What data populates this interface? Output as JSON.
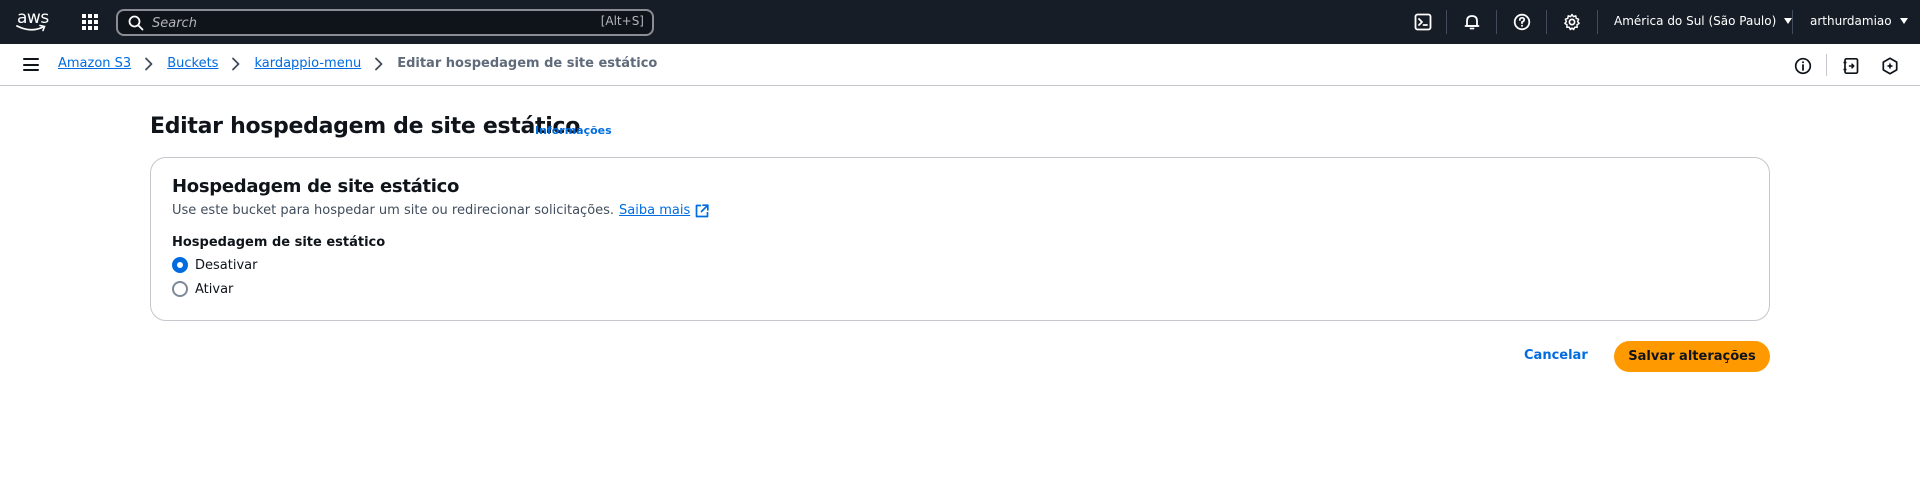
{
  "topnav": {
    "logo_text": "aws",
    "search": {
      "placeholder": "Search",
      "shortcut": "[Alt+S]"
    },
    "icons": [
      "apps-grid-icon",
      "cloudshell-icon",
      "notifications-bell-icon",
      "help-icon",
      "settings-gear-icon"
    ],
    "region": "América do Sul (São Paulo)",
    "account": "arthurdamiao"
  },
  "breadcrumb": {
    "items": [
      {
        "label": "Amazon S3"
      },
      {
        "label": "Buckets"
      },
      {
        "label": "kardappio-menu"
      }
    ],
    "current": "Editar hospedagem de site estático"
  },
  "tools": [
    "info-icon",
    "notes-icon",
    "ai-assistant-icon"
  ],
  "page": {
    "title": "Editar hospedagem de site estático",
    "info_link": "Informações"
  },
  "panel": {
    "title": "Hospedagem de site estático",
    "description": "Use este bucket para hospedar um site ou redirecionar solicitações.",
    "learn_more": "Saiba mais",
    "field_label": "Hospedagem de site estático",
    "options": [
      {
        "label": "Desativar",
        "checked": true
      },
      {
        "label": "Ativar",
        "checked": false
      }
    ]
  },
  "actions": {
    "cancel": "Cancelar",
    "save": "Salvar alterações"
  },
  "colors": {
    "nav_bg": "#161d26",
    "link": "#006ce0",
    "primary_button": "#ff9900"
  }
}
